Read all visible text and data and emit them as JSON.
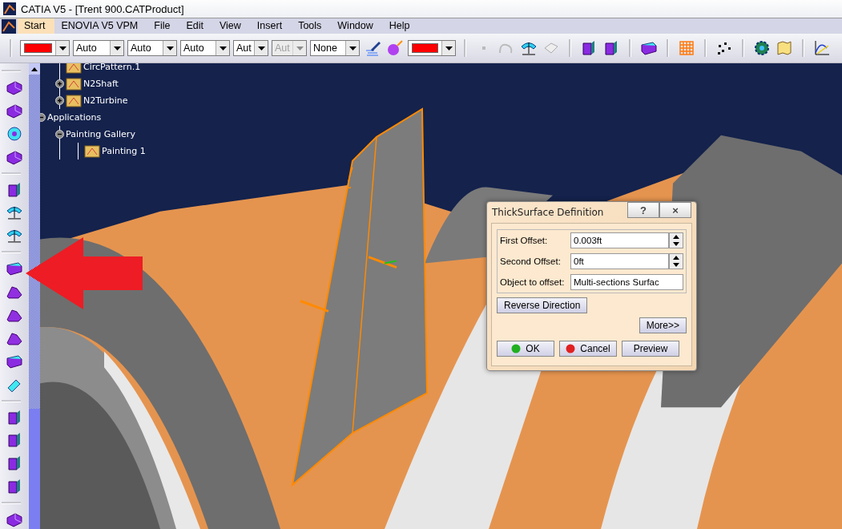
{
  "window": {
    "title": "CATIA V5 - [Trent 900.CATProduct]"
  },
  "menu": [
    {
      "label": "Start",
      "selected": true
    },
    {
      "label": "ENOVIA V5 VPM",
      "selected": false
    },
    {
      "label": "File",
      "selected": false
    },
    {
      "label": "Edit",
      "selected": false
    },
    {
      "label": "View",
      "selected": false
    },
    {
      "label": "Insert",
      "selected": false
    },
    {
      "label": "Tools",
      "selected": false
    },
    {
      "label": "Window",
      "selected": false
    },
    {
      "label": "Help",
      "selected": false
    }
  ],
  "toolbar": {
    "dropdowns": [
      {
        "kind": "color",
        "color": "#ff0000"
      },
      {
        "kind": "text",
        "value": "Auto",
        "disabled": false
      },
      {
        "kind": "text",
        "value": "Auto",
        "disabled": false
      },
      {
        "kind": "text",
        "value": "Auto",
        "disabled": false
      },
      {
        "kind": "text",
        "value": "Aut",
        "disabled": false
      },
      {
        "kind": "text",
        "value": "Aut",
        "disabled": true
      },
      {
        "kind": "text",
        "value": "None",
        "disabled": false
      }
    ],
    "end_color": {
      "kind": "color",
      "color": "#ff0000"
    }
  },
  "tree": [
    {
      "children": [
        {
          "label": "CircPattern.1"
        },
        {
          "label": "N2Shaft",
          "expanded": false
        },
        {
          "label": "N2Turbine",
          "expanded": false
        }
      ]
    },
    {
      "label": "Applications",
      "expanded": true,
      "children": [
        {
          "label": "Painting Gallery",
          "expanded": true,
          "children": [
            {
              "label": "Painting 1"
            }
          ]
        }
      ]
    }
  ],
  "dialog": {
    "title": "ThickSurface Definition",
    "help": "?",
    "close": "×",
    "fields": [
      {
        "kind": "spinner",
        "label": "First Offset:",
        "value": "0.003ft"
      },
      {
        "kind": "spinner",
        "label": "Second Offset:",
        "value": "0ft"
      },
      {
        "kind": "text",
        "label": "Object to offset:",
        "value": "Multi-sections Surfac"
      }
    ],
    "reverse_button": "Reverse Direction",
    "more_button": "More>>",
    "buttons": [
      {
        "kind": "ok",
        "label": "OK"
      },
      {
        "kind": "cancel",
        "label": "Cancel"
      },
      {
        "kind": "plain",
        "label": "Preview"
      }
    ]
  }
}
